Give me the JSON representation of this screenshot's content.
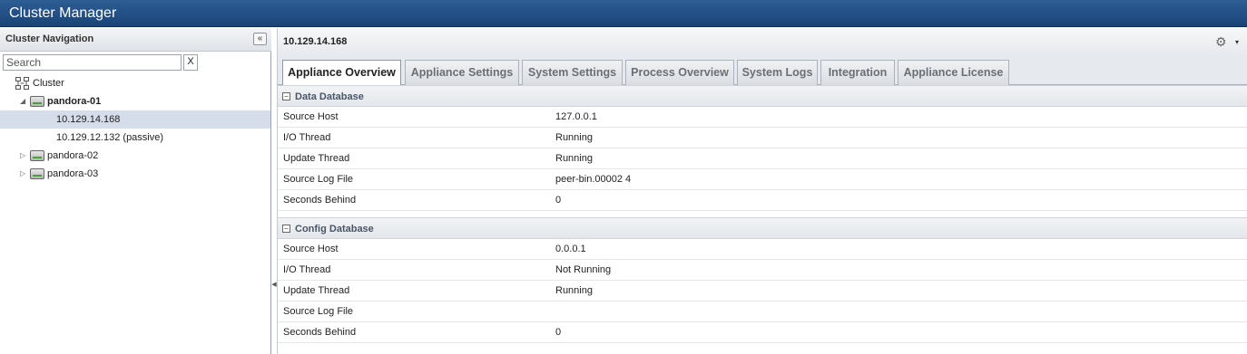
{
  "app": {
    "title": "Cluster Manager"
  },
  "nav": {
    "title": "Cluster Navigation",
    "collapse_icon": "«",
    "search": {
      "placeholder": "Search",
      "value": "",
      "clear_label": "X"
    },
    "tree": [
      {
        "label": "Cluster",
        "icon": "cluster-icon",
        "level": 0
      },
      {
        "label": "pandora-01",
        "icon": "server-icon",
        "expanded": true,
        "bold": true,
        "level": 1
      },
      {
        "label": "10.129.14.168",
        "selected": true,
        "level": 2
      },
      {
        "label": "10.129.12.132 (passive)",
        "level": 2
      },
      {
        "label": "pandora-02",
        "icon": "server-icon",
        "expanded": false,
        "level": 1
      },
      {
        "label": "pandora-03",
        "icon": "server-icon",
        "expanded": false,
        "level": 1
      }
    ]
  },
  "main": {
    "title": "10.129.14.168",
    "settings_icon": "gear-icon",
    "tabs": [
      {
        "label": "Appliance Overview",
        "active": true
      },
      {
        "label": "Appliance Settings"
      },
      {
        "label": "System Settings"
      },
      {
        "label": "Process Overview"
      },
      {
        "label": "System Logs"
      },
      {
        "label": "Integration"
      },
      {
        "label": "Appliance License"
      }
    ],
    "sections": [
      {
        "title": "Data Database",
        "toggle": "−",
        "rows": [
          {
            "key": "Source Host",
            "value": "127.0.0.1"
          },
          {
            "key": "I/O Thread",
            "value": "Running"
          },
          {
            "key": "Update Thread",
            "value": "Running"
          },
          {
            "key": "Source Log File",
            "value": "peer-bin.00002 4"
          },
          {
            "key": "Seconds Behind",
            "value": "0"
          }
        ]
      },
      {
        "title": "Config Database",
        "toggle": "−",
        "rows": [
          {
            "key": "Source Host",
            "value": "0.0.0.1"
          },
          {
            "key": "I/O Thread",
            "value": "Not Running"
          },
          {
            "key": "Update Thread",
            "value": "Running"
          },
          {
            "key": "Source Log File",
            "value": ""
          },
          {
            "key": "Seconds Behind",
            "value": "0"
          }
        ]
      }
    ]
  },
  "colors": {
    "titlebar": "#1f4b80",
    "selected_row": "#d5dcea",
    "section_title": "#4a5566"
  }
}
